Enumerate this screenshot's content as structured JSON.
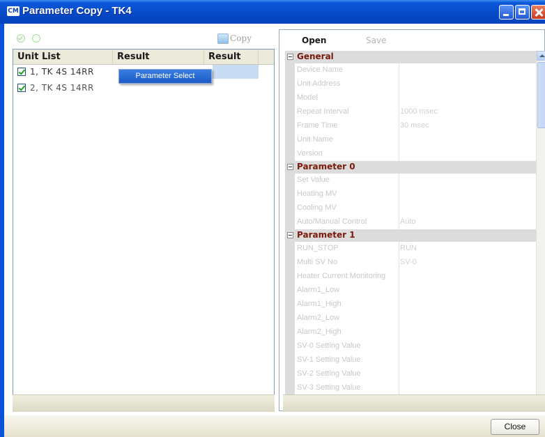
{
  "window": {
    "logo_text": "CM",
    "title": "Parameter Copy - TK4"
  },
  "left": {
    "toolbar": {
      "copy_label": "Copy"
    },
    "columns": [
      "Unit List",
      "Result",
      "Result"
    ],
    "rows": [
      {
        "label": "1, TK 4S 14RR",
        "checked": true
      },
      {
        "label": "2, TK 4S 14RR",
        "checked": true
      }
    ],
    "context_menu": {
      "item": "Parameter Select"
    }
  },
  "right": {
    "toolbar": {
      "open_label": "Open",
      "save_label": "Save"
    },
    "groups": [
      {
        "title": "General",
        "params": [
          {
            "name": "Device Name",
            "value": ""
          },
          {
            "name": "Unit Address",
            "value": ""
          },
          {
            "name": "Model",
            "value": ""
          },
          {
            "name": "Repeat Interval",
            "value": "1000 msec"
          },
          {
            "name": "Frame Time",
            "value": "30 msec"
          },
          {
            "name": "Unit Name",
            "value": ""
          },
          {
            "name": "Version",
            "value": ""
          }
        ]
      },
      {
        "title": "Parameter 0",
        "params": [
          {
            "name": "Set Value",
            "value": ""
          },
          {
            "name": "Heating MV",
            "value": ""
          },
          {
            "name": "Cooling MV",
            "value": ""
          },
          {
            "name": "Auto/Manual Control",
            "value": "Auto"
          }
        ]
      },
      {
        "title": "Parameter 1",
        "params": [
          {
            "name": "RUN_STOP",
            "value": "RUN"
          },
          {
            "name": "Multi SV No",
            "value": "SV-0"
          },
          {
            "name": "Heater Current Monitoring",
            "value": ""
          },
          {
            "name": "Alarm1_Low",
            "value": ""
          },
          {
            "name": "Alarm1_High",
            "value": ""
          },
          {
            "name": "Alarm2_Low",
            "value": ""
          },
          {
            "name": "Alarm2_High",
            "value": ""
          },
          {
            "name": "SV-0 Setting Value",
            "value": ""
          },
          {
            "name": "SV-1 Setting Value",
            "value": ""
          },
          {
            "name": "SV-2 Setting Value",
            "value": ""
          },
          {
            "name": "SV-3 Setting Value",
            "value": ""
          }
        ]
      }
    ]
  },
  "footer": {
    "close_label": "Close"
  },
  "colors": {
    "title_bar": "#0a57d8",
    "group_text": "#7a1a0a",
    "selection": "#c8dcf4"
  }
}
